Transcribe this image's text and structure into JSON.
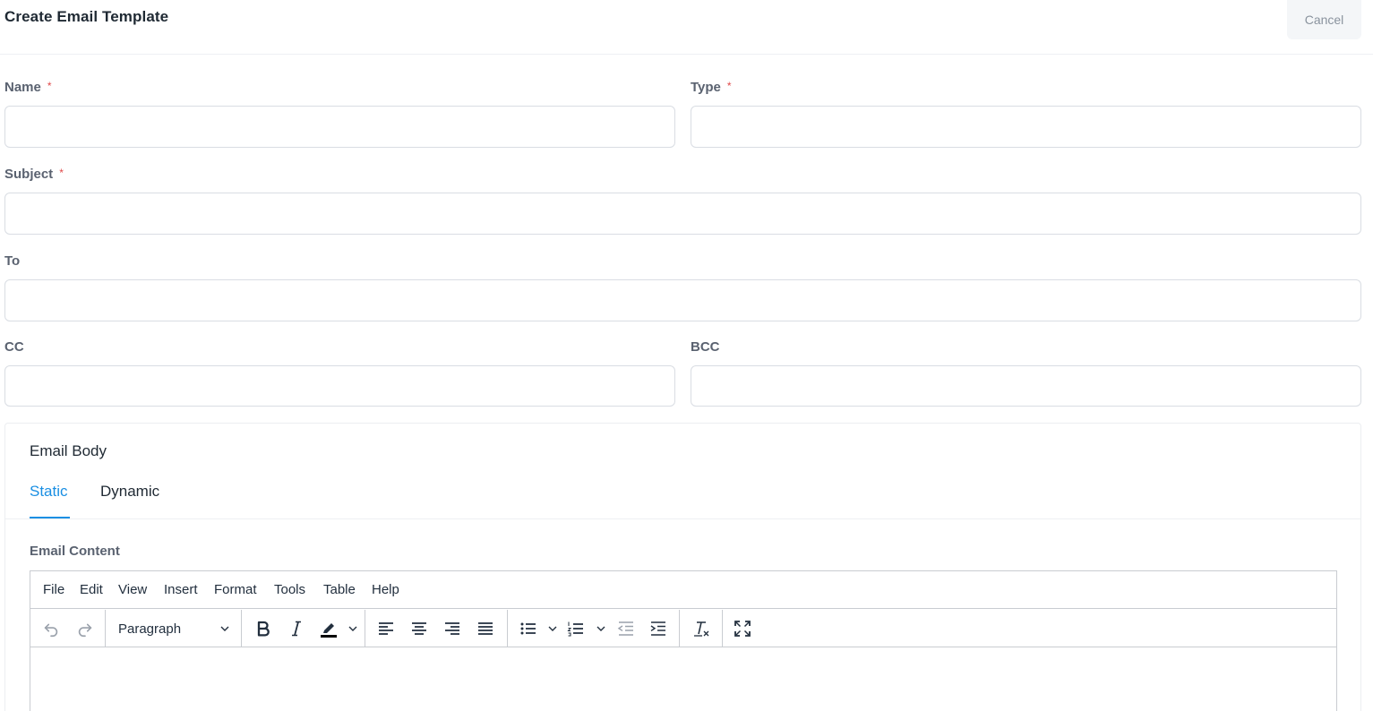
{
  "header": {
    "title": "Create Email Template",
    "cancel_label": "Cancel"
  },
  "form": {
    "name": {
      "label": "Name",
      "required": "*",
      "value": ""
    },
    "type": {
      "label": "Type",
      "required": "*",
      "value": ""
    },
    "subject": {
      "label": "Subject",
      "required": "*",
      "value": ""
    },
    "to": {
      "label": "To",
      "value": ""
    },
    "cc": {
      "label": "CC",
      "value": ""
    },
    "bcc": {
      "label": "BCC",
      "value": ""
    }
  },
  "email_body": {
    "title": "Email Body",
    "tabs": [
      {
        "label": "Static",
        "active": true
      },
      {
        "label": "Dynamic",
        "active": false
      }
    ],
    "content_label": "Email Content"
  },
  "editor": {
    "menu": [
      "File",
      "Edit",
      "View",
      "Insert",
      "Format",
      "Tools",
      "Table",
      "Help"
    ],
    "block_format": "Paragraph",
    "toolbar_icons": [
      "undo-icon",
      "redo-icon",
      "bold-icon",
      "italic-icon",
      "highlight-icon",
      "align-left-icon",
      "align-center-icon",
      "align-right-icon",
      "align-justify-icon",
      "bullet-list-icon",
      "numbered-list-icon",
      "outdent-icon",
      "indent-icon",
      "clear-formatting-icon",
      "fullscreen-icon"
    ]
  },
  "colors": {
    "accent": "#1a8fe3",
    "required": "#e04848",
    "label": "#5a6270",
    "border": "#d9dde3"
  }
}
